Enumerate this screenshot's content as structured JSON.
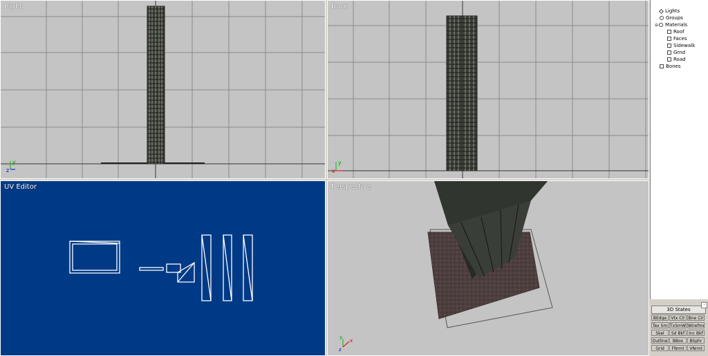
{
  "viewports": {
    "right": {
      "title": "Right"
    },
    "back": {
      "title": "Back"
    },
    "uv": {
      "title": "UV Editor"
    },
    "perspective": {
      "title": "Perspective"
    }
  },
  "axes": {
    "x": "x",
    "y": "y",
    "z": "z"
  },
  "colors": {
    "viewport_bg": "#c4c4c4",
    "uv_bg": "#003a86",
    "grid_line": "#8a8a8a",
    "axis_x": "#e00000",
    "axis_y": "#00c000",
    "axis_z": "#0000e0"
  },
  "scene_tree": {
    "items": [
      {
        "label": "Lights",
        "icon": "light-icon"
      },
      {
        "label": "Groups",
        "icon": "group-icon"
      },
      {
        "label": "Materials",
        "icon": "materials-icon"
      },
      {
        "label": "Roof",
        "icon": "material-icon"
      },
      {
        "label": "Faces",
        "icon": "material-icon"
      },
      {
        "label": "Sidewalk",
        "icon": "material-icon"
      },
      {
        "label": "Grnd",
        "icon": "material-icon"
      },
      {
        "label": "Road",
        "icon": "material-icon"
      },
      {
        "label": "Bones",
        "icon": "bones-icon"
      }
    ]
  },
  "states": {
    "title": "3D States",
    "collapse": "-",
    "buttons": [
      [
        "BEdge",
        "Vtx Clr",
        "Bne Clr"
      ],
      [
        "Tex Sm",
        "TxSmWr",
        "Wirefme"
      ],
      [
        "Skel",
        "Sd Bkf",
        "Inc Bkf"
      ],
      [
        "Outline",
        "BBox",
        "BSphr"
      ],
      [
        "Grid",
        "FNrml",
        "VNrml"
      ]
    ]
  }
}
